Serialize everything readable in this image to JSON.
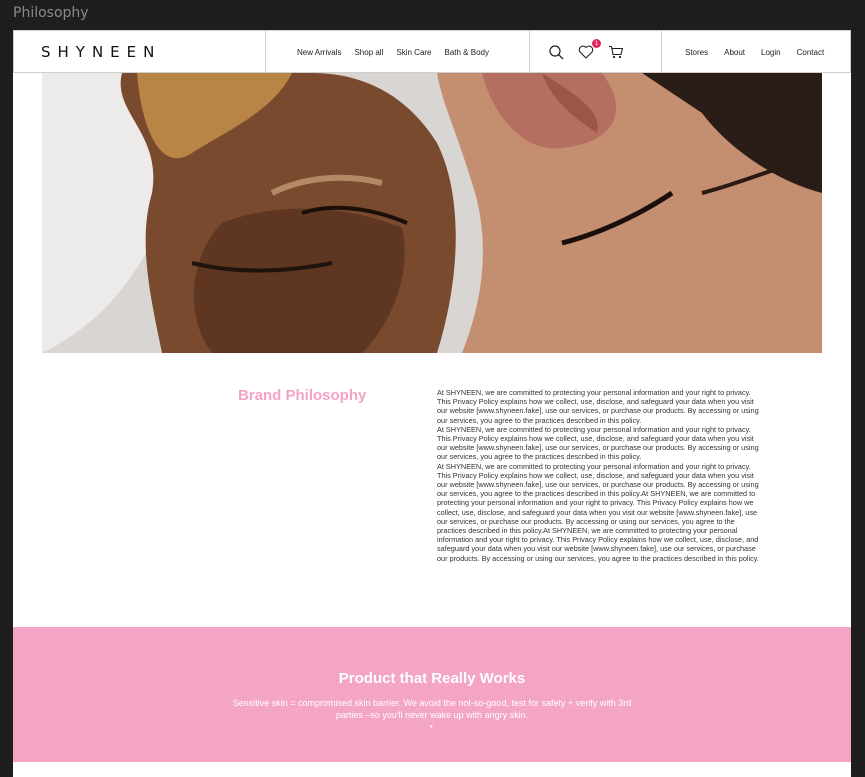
{
  "frame": {
    "label": "Philosophy"
  },
  "header": {
    "logo": "SHYNEEN",
    "nav_primary": [
      "New Arrivals",
      "Shop all",
      "Skin Care",
      "Bath & Body"
    ],
    "icons": [
      "search-icon",
      "heart-icon",
      "cart-icon"
    ],
    "wishlist_count": "1",
    "nav_secondary": [
      "Stores",
      "About",
      "Login",
      "Contact"
    ]
  },
  "hero": {
    "description_icon": "hero-image"
  },
  "philosophy": {
    "title": "Brand Philosophy",
    "paragraphs": [
      "At SHYNEEN, we are committed to protecting your personal information and your right to privacy. This Privacy Policy explains how we collect, use, disclose, and safeguard your data when you visit our website [www.shyneen.fake], use our services, or purchase our products. By accessing or using our services, you agree to the practices described in this policy.",
      "At SHYNEEN, we are committed to protecting your personal information and your right to privacy. This Privacy Policy explains how we collect, use, disclose, and safeguard your data when you visit our website [www.shyneen.fake], use our services, or purchase our products. By accessing or using our services, you agree to the practices described in this policy.",
      "At SHYNEEN, we are committed to protecting your personal information and your right to privacy. This Privacy Policy explains how we collect, use, disclose, and safeguard your data when you visit our website [www.shyneen.fake], use our services, or purchase our products. By accessing or using our services, you agree to the practices described in this policy.At SHYNEEN, we are committed to protecting your personal information and your right to privacy. This Privacy Policy explains how we collect, use, disclose, and safeguard your data when you visit our website [www.shyneen.fake], use our services, or purchase our products. By accessing or using our services, you agree to the practices described in this policy.At SHYNEEN, we are committed to protecting your personal information and your right to privacy. This Privacy Policy explains how we collect, use, disclose, and safeguard your data when you visit our website [www.shyneen.fake], use our services, or purchase our products. By accessing or using our services, you agree to the practices described in this policy."
    ]
  },
  "band": {
    "title": "Product that Really Works",
    "text": "Sensitive skin = compromised skin barrier. We avoid the not-so-good, test for safety + verify with 3rd parties –so you'll never wake up with angry skin.",
    "dot": "•"
  },
  "colors": {
    "pink": "#f4a4c5",
    "title_pink": "#f4a3c4",
    "badge": "#e0245e"
  }
}
